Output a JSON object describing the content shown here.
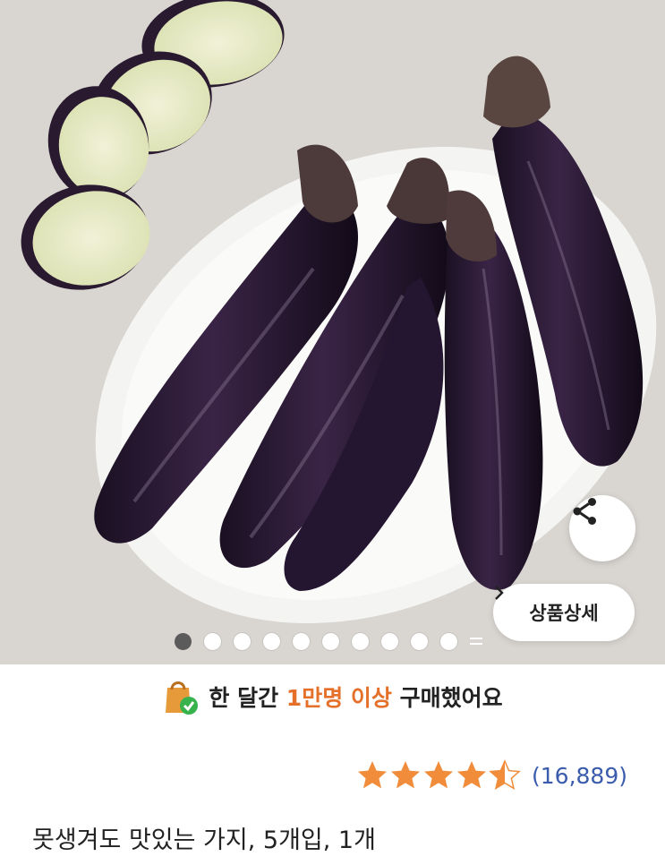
{
  "hero": {
    "image_alt": "eggplants on a white plate with sliced eggplant",
    "share_icon": "share-icon",
    "detail_button": {
      "label": "상품상세",
      "icon": "chevron-right-icon"
    },
    "carousel": {
      "total_dots": 10,
      "active_index": 0,
      "more_icon": "menu-more-icon"
    }
  },
  "purchase_banner": {
    "icon": "shopping-bag-check-icon",
    "prefix": "한 달간",
    "highlight": "1만명 이상",
    "suffix": "구매했어요",
    "highlight_color": "#e4702a"
  },
  "rating": {
    "stars": 4.5,
    "max_stars": 5,
    "count": "(16,889)",
    "star_color": "#f08c3a"
  },
  "product": {
    "title": "못생겨도 맛있는 가지, 5개입, 1개"
  }
}
